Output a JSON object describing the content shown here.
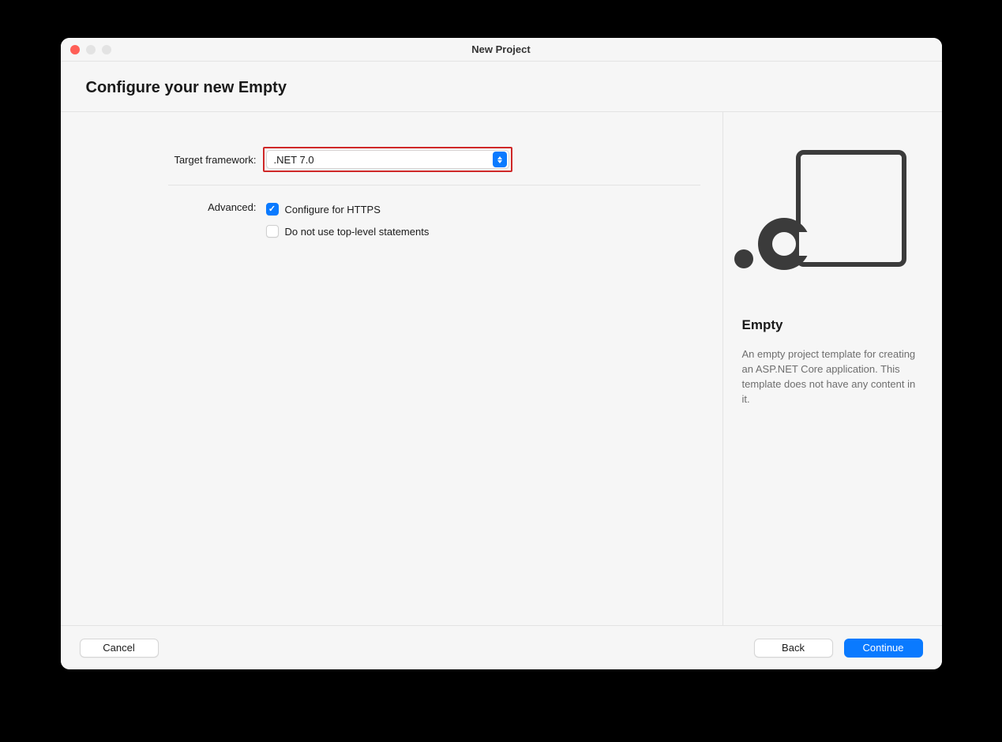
{
  "window": {
    "title": "New Project"
  },
  "header": {
    "title": "Configure your new Empty"
  },
  "form": {
    "target_framework_label": "Target framework:",
    "target_framework_value": ".NET 7.0",
    "advanced_label": "Advanced:",
    "options": {
      "https": {
        "label": "Configure for HTTPS",
        "checked": true
      },
      "top_level": {
        "label": "Do not use top-level statements",
        "checked": false
      }
    }
  },
  "info": {
    "template_name": "Empty",
    "template_description": "An empty project template for creating an ASP.NET Core application. This template does not have any content in it."
  },
  "footer": {
    "cancel": "Cancel",
    "back": "Back",
    "continue": "Continue"
  }
}
